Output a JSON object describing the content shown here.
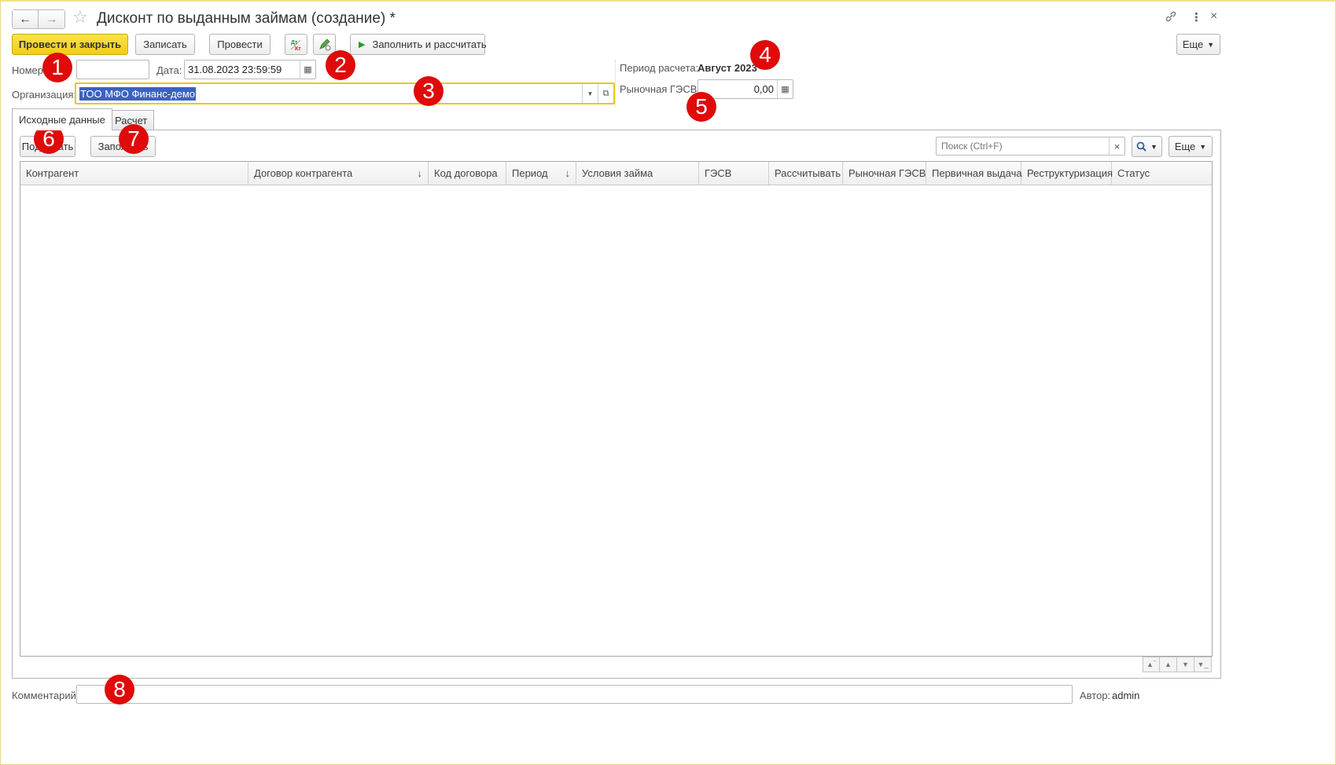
{
  "window": {
    "title": "Дисконт по выданным займам (создание) *"
  },
  "toolbar": {
    "post_close": "Провести и закрыть",
    "save": "Записать",
    "post": "Провести",
    "dtkt_icon_text": "Дт Кт",
    "fill_calc": "Заполнить и рассчитать",
    "more": "Еще"
  },
  "form": {
    "number_label": "Номер:",
    "number_value": "",
    "date_label": "Дата:",
    "date_value": "31.08.2023 23:59:59",
    "org_label": "Организация:",
    "org_value": "ТОО МФО Финанс-демо",
    "period_label": "Период расчета:",
    "period_value": "Август 2023",
    "market_label": "Рыночная ГЭСВ:",
    "market_value": "0,00"
  },
  "tabs": [
    {
      "label": "Исходные данные"
    },
    {
      "label": "Расчет"
    }
  ],
  "table_toolbar": {
    "select": "Подобрать",
    "fill": "Заполнить",
    "search_placeholder": "Поиск (Ctrl+F)",
    "more": "Еще"
  },
  "table": {
    "columns": [
      {
        "label": "Контрагент",
        "sort": ""
      },
      {
        "label": "Договор контрагента",
        "sort": "↓"
      },
      {
        "label": "Код договора",
        "sort": ""
      },
      {
        "label": "Период",
        "sort": "↓"
      },
      {
        "label": "Условия займа",
        "sort": ""
      },
      {
        "label": "ГЭСВ",
        "sort": ""
      },
      {
        "label": "Рассчитывать",
        "sort": ""
      },
      {
        "label": "Рыночная ГЭСВ",
        "sort": ""
      },
      {
        "label": "Первичная выдача",
        "sort": ""
      },
      {
        "label": "Реструктуризация",
        "sort": ""
      },
      {
        "label": "Статус",
        "sort": ""
      }
    ],
    "rows": []
  },
  "footer": {
    "comment_label": "Комментарий:",
    "comment_value": "",
    "author_label": "Автор:",
    "author_value": "admin"
  },
  "callouts": [
    "1",
    "2",
    "3",
    "4",
    "5",
    "6",
    "7",
    "8"
  ],
  "colors": {
    "primary_button": "#f3cc12",
    "callout": "#e00a0a",
    "selection": "#3b62c2",
    "org_focus_border": "#f0c419"
  }
}
